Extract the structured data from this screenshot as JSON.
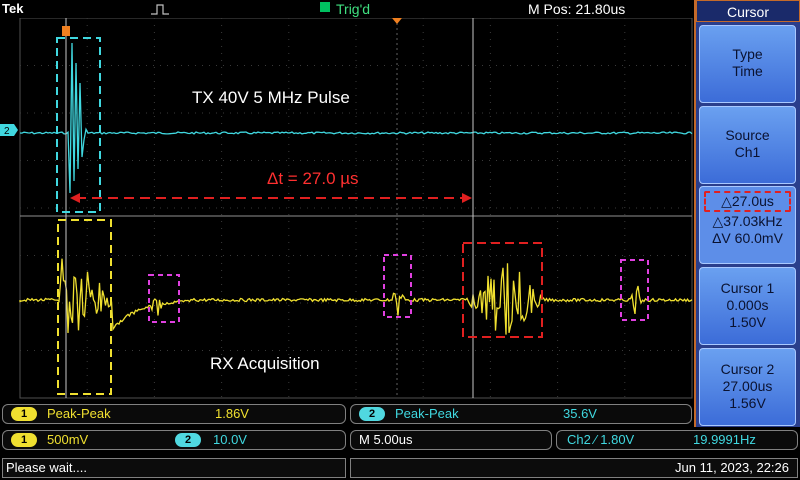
{
  "topbar": {
    "brand": "Tek",
    "trigger_status": "Trig'd",
    "m_pos": "M Pos: 21.80us"
  },
  "screen": {
    "annotation_tx": "TX 40V 5 MHz Pulse",
    "annotation_rx": "RX Acquisition",
    "delta_t_label": "Δt = 27.0 µs",
    "ch2_marker": "2",
    "ch1_marker_glyph": "T"
  },
  "menu": {
    "title": "Cursor",
    "type_label": "Type",
    "type_value": "Time",
    "source_label": "Source",
    "source_value": "Ch1",
    "delta_time": "△27.0us",
    "delta_freq": "△37.03kHz",
    "delta_v": "ΔV 60.0mV",
    "cursor1_label": "Cursor 1",
    "cursor1_time": "0.000s",
    "cursor1_v": "1.50V",
    "cursor2_label": "Cursor 2",
    "cursor2_time": "27.00us",
    "cursor2_v": "1.56V"
  },
  "measurements": {
    "m1_channel": "1",
    "m1_type": "Peak-Peak",
    "m1_value": "1.86V",
    "m2_channel": "2",
    "m2_type": "Peak-Peak",
    "m2_value": "35.6V"
  },
  "settings": {
    "ch1_badge": "1",
    "ch1_scale": "500mV",
    "ch2_badge": "2",
    "ch2_scale": "10.0V",
    "timebase": "M 5.00us",
    "trigger": "Ch2 ∕ 1.80V",
    "frequency": "19.9991Hz"
  },
  "status": {
    "message": "Please wait....",
    "datetime": "Jun 11, 2023, 22:26"
  },
  "colors": {
    "ch1": "#f0e030",
    "ch2": "#40d8e0",
    "annotation_red": "#e02020",
    "annotation_magenta": "#e040e0",
    "menu_blue": "#3c6cd8"
  }
}
